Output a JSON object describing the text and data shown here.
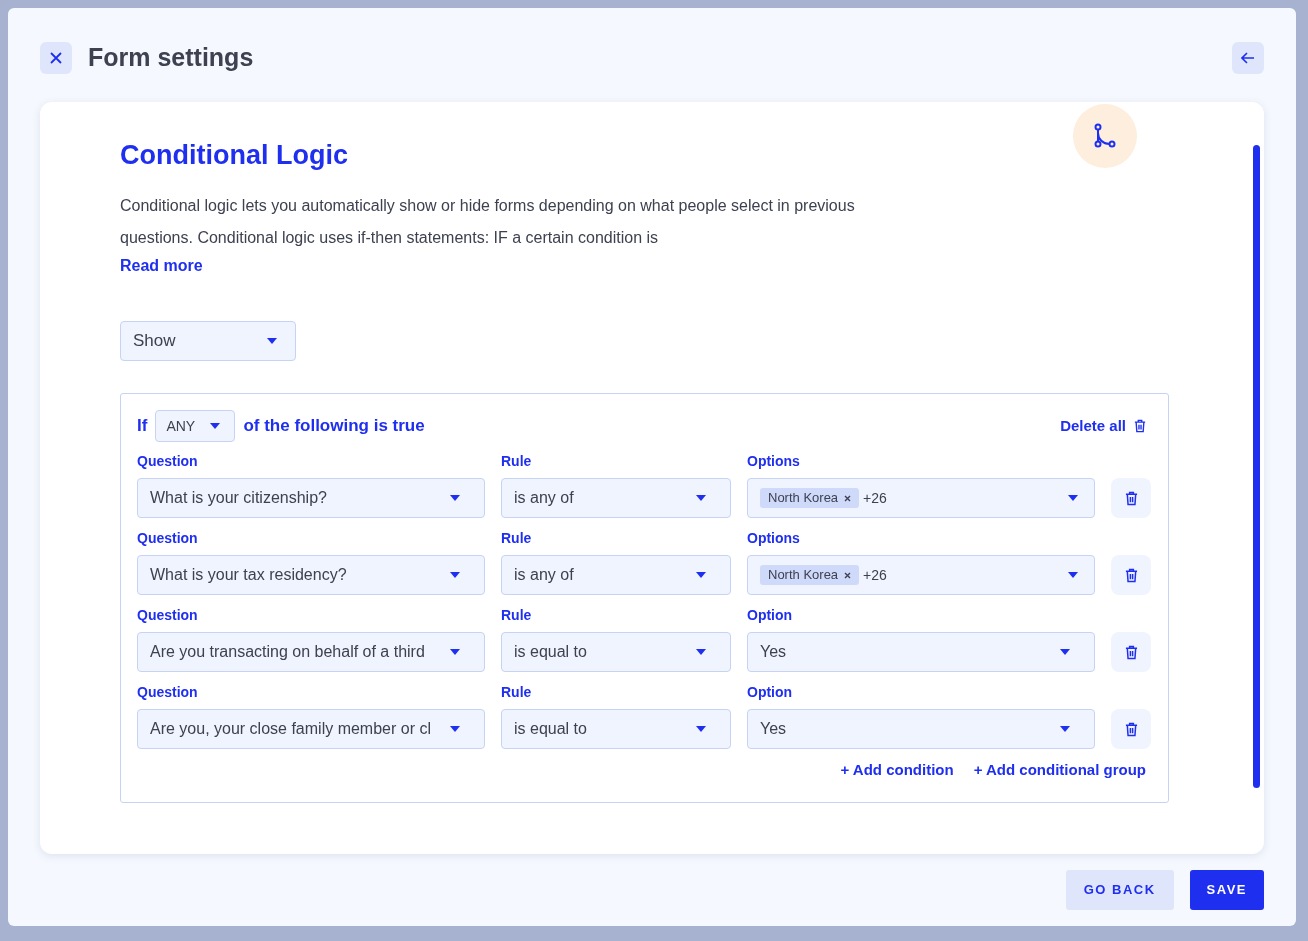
{
  "header": {
    "title": "Form settings"
  },
  "section": {
    "title": "Conditional Logic",
    "description": "Conditional logic lets you automatically show or hide forms depending on what people select in previous questions. Conditional logic uses if-then statements: IF a certain condition is",
    "read_more": "Read more"
  },
  "action_select": {
    "value": "Show"
  },
  "condition_group": {
    "prefix": "If",
    "match_select": {
      "value": "ANY"
    },
    "suffix": "of the following is true",
    "delete_all": "Delete all",
    "conditions": [
      {
        "question_label": "Question",
        "question": "What is your citizenship?",
        "rule_label": "Rule",
        "rule": "is any of",
        "options_label": "Options",
        "kind": "tags",
        "tags": [
          "North Korea"
        ],
        "more": "+26"
      },
      {
        "question_label": "Question",
        "question": "What is your tax residency?",
        "rule_label": "Rule",
        "rule": "is any of",
        "options_label": "Options",
        "kind": "tags",
        "tags": [
          "North Korea"
        ],
        "more": "+26"
      },
      {
        "question_label": "Question",
        "question": "Are you transacting on behalf of a third",
        "rule_label": "Rule",
        "rule": "is equal to",
        "options_label": "Option",
        "kind": "single",
        "value": "Yes"
      },
      {
        "question_label": "Question",
        "question": "Are you, your close family member or cl",
        "rule_label": "Rule",
        "rule": "is equal to",
        "options_label": "Option",
        "kind": "single",
        "value": "Yes"
      }
    ],
    "add_condition": "+ Add condition",
    "add_group": "+ Add conditional group"
  },
  "footer": {
    "buttons": [
      {
        "label": "GO BACK",
        "kind": "secondary"
      },
      {
        "label": "SAVE",
        "kind": "primary"
      }
    ]
  }
}
